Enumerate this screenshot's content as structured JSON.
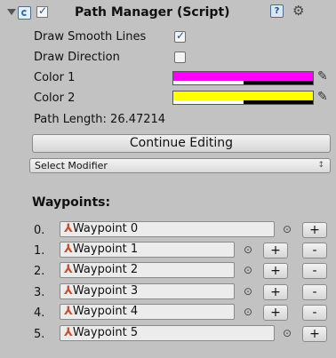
{
  "component": {
    "title": "Path Manager (Script)",
    "enabled": true
  },
  "fields": {
    "draw_smooth_lines": {
      "label": "Draw Smooth Lines",
      "checked": true
    },
    "draw_direction": {
      "label": "Draw Direction",
      "checked": false
    },
    "color1": {
      "label": "Color 1",
      "color": "#ff00ff",
      "alpha": 0.5
    },
    "color2": {
      "label": "Color 2",
      "color": "#ffff00",
      "alpha": 0.5
    },
    "path_length": "Path Length: 26.47214"
  },
  "continue_button": "Continue Editing",
  "select_modifier": {
    "value": "Select Modifier",
    "arrow": "↕"
  },
  "waypoints": {
    "title": "Waypoints:",
    "add_label": "+",
    "remove_label": "-",
    "target_glyph": "⊙",
    "items": [
      {
        "index": "0.",
        "name": "Waypoint 0"
      },
      {
        "index": "1.",
        "name": "Waypoint 1"
      },
      {
        "index": "2.",
        "name": "Waypoint 2"
      },
      {
        "index": "3.",
        "name": "Waypoint 3"
      },
      {
        "index": "4.",
        "name": "Waypoint 4"
      },
      {
        "index": "5.",
        "name": "Waypoint 5"
      }
    ]
  }
}
